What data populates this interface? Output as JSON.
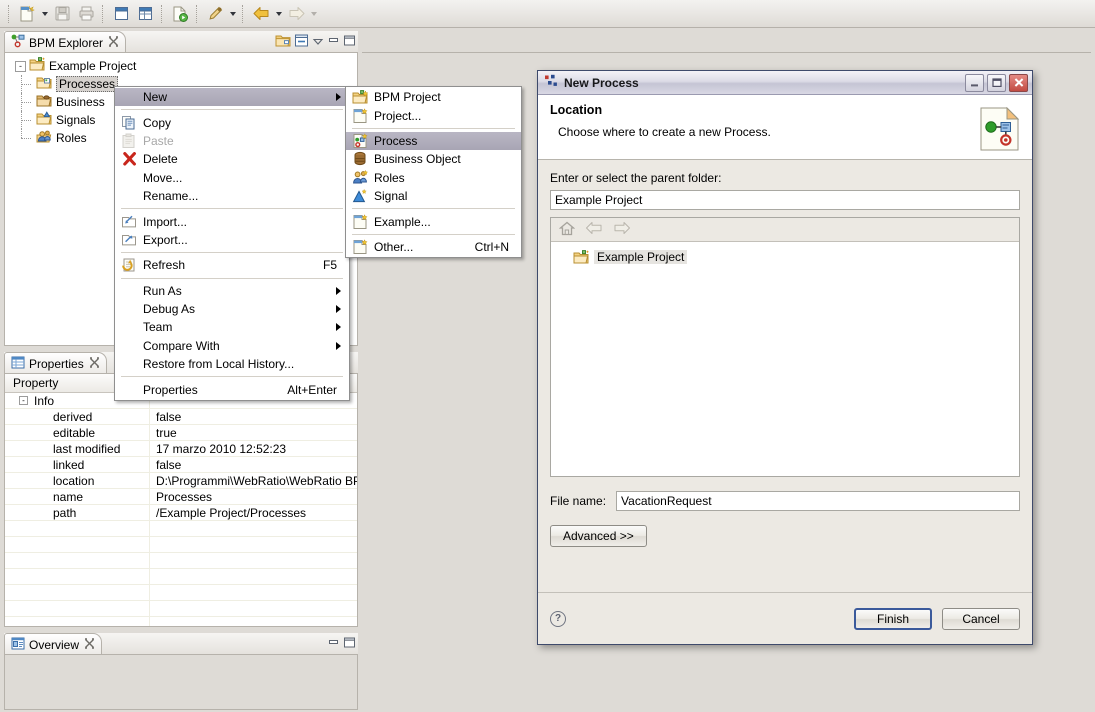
{
  "toolbar": {
    "buttons": [
      {
        "name": "new-wizard-button",
        "icon": "new-document-icon"
      },
      {
        "name": "new-dropdown-arrow",
        "icon": "chevron-down-icon"
      },
      {
        "name": "save-button",
        "icon": "save-disk-icon"
      },
      {
        "name": "print-button",
        "icon": "printer-icon"
      },
      {
        "name": "maximize-view-button",
        "icon": "window-icon"
      },
      {
        "name": "restore-view-button",
        "icon": "window-split-icon"
      },
      {
        "name": "run-button",
        "icon": "run-document-icon"
      },
      {
        "name": "annotate-button",
        "icon": "pen-icon"
      },
      {
        "name": "annotate-dropdown-arrow",
        "icon": "chevron-down-icon"
      },
      {
        "name": "back-button",
        "icon": "back-arrow-icon"
      },
      {
        "name": "back-dropdown-arrow",
        "icon": "chevron-down-icon"
      },
      {
        "name": "forward-button",
        "icon": "forward-arrow-icon"
      },
      {
        "name": "forward-dropdown-arrow",
        "icon": "chevron-down-icon"
      }
    ]
  },
  "explorer": {
    "tab_label": "BPM Explorer",
    "tab_icon": "bpm-explorer-icon",
    "close_icon": "close-icon",
    "tools": [
      {
        "name": "link-with-editor-button",
        "icon": "folder-link-icon"
      },
      {
        "name": "collapse-all-button",
        "icon": "collapse-all-icon"
      },
      {
        "name": "view-menu-button",
        "icon": "chevron-down-icon"
      },
      {
        "name": "minimize-view-button",
        "icon": "minimize-icon"
      },
      {
        "name": "maximize-view-button",
        "icon": "maximize-icon"
      }
    ],
    "tree": {
      "root": {
        "label": "Example Project",
        "icon": "project-folder-icon",
        "expander": "-"
      },
      "children": [
        {
          "label": "Processes",
          "icon": "processes-folder-icon",
          "selected": true
        },
        {
          "label": "Business ",
          "icon": "business-object-folder-icon",
          "selected": false
        },
        {
          "label": "Signals",
          "icon": "signals-folder-icon",
          "selected": false
        },
        {
          "label": "Roles",
          "icon": "roles-folder-icon",
          "selected": false
        }
      ]
    }
  },
  "properties": {
    "tab_label": "Properties",
    "tab_icon": "properties-table-icon",
    "close_icon": "close-icon",
    "columns": [
      "Property",
      ""
    ],
    "group": {
      "label": "Info",
      "expander": "-"
    },
    "rows": [
      {
        "property": "derived",
        "value": "false"
      },
      {
        "property": "editable",
        "value": "true"
      },
      {
        "property": "last modified",
        "value": "17 marzo 2010 12:52:23"
      },
      {
        "property": "linked",
        "value": "false"
      },
      {
        "property": "location",
        "value": "D:\\Programmi\\WebRatio\\WebRatio BP..."
      },
      {
        "property": "name",
        "value": "Processes"
      },
      {
        "property": "path",
        "value": "/Example Project/Processes"
      }
    ]
  },
  "overview": {
    "tab_label": "Overview",
    "tab_icon": "overview-icon",
    "close_icon": "close-icon",
    "tools": [
      {
        "name": "minimize-view-button",
        "icon": "minimize-icon"
      },
      {
        "name": "maximize-view-button",
        "icon": "maximize-icon"
      }
    ]
  },
  "context_menu": {
    "items": [
      {
        "label": "New",
        "icon": null,
        "accel": "",
        "submenu": true,
        "highlighted": true,
        "disabled": false
      },
      {
        "separator": true
      },
      {
        "label": "Copy",
        "icon": "copy-icon",
        "accel": "",
        "submenu": false,
        "highlighted": false,
        "disabled": false
      },
      {
        "label": "Paste",
        "icon": "paste-icon",
        "accel": "",
        "submenu": false,
        "highlighted": false,
        "disabled": true
      },
      {
        "label": "Delete",
        "icon": "delete-x-icon",
        "accel": "",
        "submenu": false,
        "highlighted": false,
        "disabled": false
      },
      {
        "label": "Move...",
        "icon": null,
        "accel": "",
        "submenu": false,
        "highlighted": false,
        "disabled": false
      },
      {
        "label": "Rename...",
        "icon": null,
        "accel": "",
        "submenu": false,
        "highlighted": false,
        "disabled": false
      },
      {
        "separator": true
      },
      {
        "label": "Import...",
        "icon": "import-icon",
        "accel": "",
        "submenu": false,
        "highlighted": false,
        "disabled": false
      },
      {
        "label": "Export...",
        "icon": "export-icon",
        "accel": "",
        "submenu": false,
        "highlighted": false,
        "disabled": false
      },
      {
        "separator": true
      },
      {
        "label": "Refresh",
        "icon": "refresh-icon",
        "accel": "F5",
        "submenu": false,
        "highlighted": false,
        "disabled": false
      },
      {
        "separator": true
      },
      {
        "label": "Run As",
        "icon": null,
        "accel": "",
        "submenu": true,
        "highlighted": false,
        "disabled": false
      },
      {
        "label": "Debug As",
        "icon": null,
        "accel": "",
        "submenu": true,
        "highlighted": false,
        "disabled": false
      },
      {
        "label": "Team",
        "icon": null,
        "accel": "",
        "submenu": true,
        "highlighted": false,
        "disabled": false
      },
      {
        "label": "Compare With",
        "icon": null,
        "accel": "",
        "submenu": true,
        "highlighted": false,
        "disabled": false
      },
      {
        "label": "Restore from Local History...",
        "icon": null,
        "accel": "",
        "submenu": false,
        "highlighted": false,
        "disabled": false
      },
      {
        "separator": true
      },
      {
        "label": "Properties",
        "icon": null,
        "accel": "Alt+Enter",
        "submenu": false,
        "highlighted": false,
        "disabled": false
      }
    ]
  },
  "sub_menu": {
    "items": [
      {
        "label": "BPM Project",
        "icon": "bpm-project-icon",
        "accel": "",
        "highlighted": false
      },
      {
        "label": "Project...",
        "icon": "project-icon",
        "accel": "",
        "highlighted": false
      },
      {
        "separator": true
      },
      {
        "label": "Process",
        "icon": "process-icon",
        "accel": "",
        "highlighted": true
      },
      {
        "label": "Business Object",
        "icon": "business-object-icon",
        "accel": "",
        "highlighted": false
      },
      {
        "label": "Roles",
        "icon": "roles-icon",
        "accel": "",
        "highlighted": false
      },
      {
        "label": "Signal",
        "icon": "signal-icon",
        "accel": "",
        "highlighted": false
      },
      {
        "separator": true
      },
      {
        "label": "Example...",
        "icon": "example-icon",
        "accel": "",
        "highlighted": false
      },
      {
        "separator": true
      },
      {
        "label": "Other...",
        "icon": "other-icon",
        "accel": "Ctrl+N",
        "highlighted": false
      }
    ]
  },
  "dialog": {
    "title": "New Process",
    "title_icon": "new-process-icon",
    "window_buttons": [
      {
        "name": "minimize-button",
        "icon": "minimize-icon"
      },
      {
        "name": "maximize-button",
        "icon": "maximize-icon"
      },
      {
        "name": "close-button",
        "icon": "close-x-icon"
      }
    ],
    "heading": "Location",
    "description": "Choose where to create a new Process.",
    "banner_icon": "new-process-wizard-icon",
    "parent_folder_label": "Enter or select the parent folder:",
    "parent_folder_value": "Example Project",
    "tree_toolbar": [
      {
        "name": "home-button",
        "icon": "home-icon"
      },
      {
        "name": "back-button",
        "icon": "back-arrow-icon"
      },
      {
        "name": "forward-button",
        "icon": "forward-arrow-icon"
      }
    ],
    "tree_items": [
      {
        "label": "Example Project",
        "icon": "project-folder-icon",
        "selected": true
      }
    ],
    "file_name_label": "File name:",
    "file_name_value": "VacationRequest",
    "advanced_button": "Advanced >>",
    "help_icon": "help-question-icon",
    "finish_button": "Finish",
    "cancel_button": "Cancel",
    "accent_color": "#3b5a9b"
  }
}
